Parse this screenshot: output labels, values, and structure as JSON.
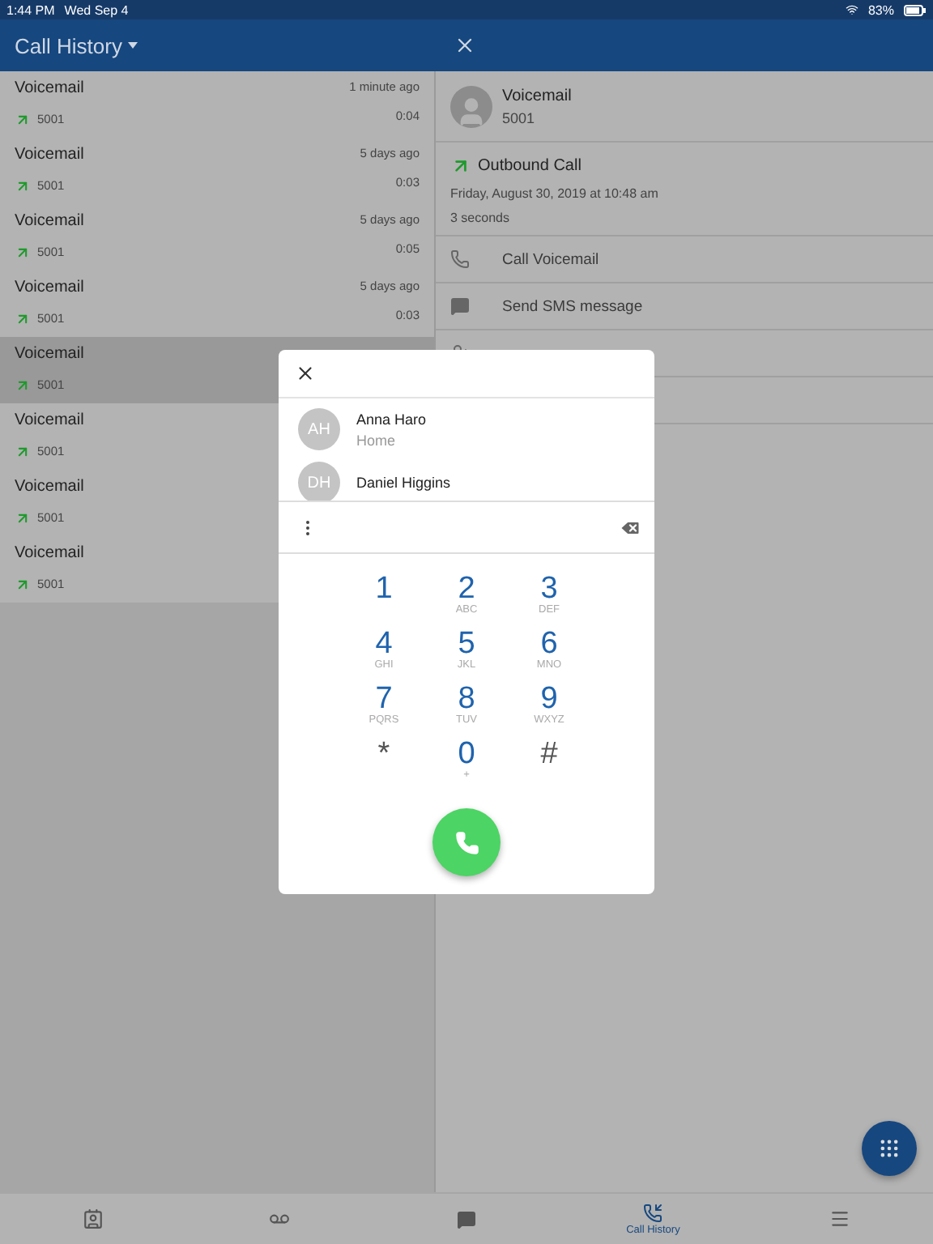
{
  "status_bar": {
    "time": "1:44 PM",
    "date": "Wed Sep 4",
    "battery": "83%"
  },
  "header": {
    "title": "Call History"
  },
  "calls": [
    {
      "name": "Voicemail",
      "number": "5001",
      "when": "1 minute ago",
      "duration": "0:04",
      "selected": false
    },
    {
      "name": "Voicemail",
      "number": "5001",
      "when": "5 days ago",
      "duration": "0:03",
      "selected": false
    },
    {
      "name": "Voicemail",
      "number": "5001",
      "when": "5 days ago",
      "duration": "0:05",
      "selected": false
    },
    {
      "name": "Voicemail",
      "number": "5001",
      "when": "5 days ago",
      "duration": "0:03",
      "selected": false
    },
    {
      "name": "Voicemail",
      "number": "5001",
      "selected": true
    },
    {
      "name": "Voicemail",
      "number": "5001",
      "selected": false
    },
    {
      "name": "Voicemail",
      "number": "5001",
      "selected": false
    },
    {
      "name": "Voicemail",
      "number": "5001",
      "selected": false
    }
  ],
  "detail": {
    "name": "Voicemail",
    "number": "5001",
    "direction": "Outbound Call",
    "date": "Friday, August 30, 2019 at 10:48 am",
    "length": "3 seconds",
    "actions": [
      {
        "kind": "call",
        "label": "Call Voicemail"
      },
      {
        "kind": "sms",
        "label": "Send SMS message"
      },
      {
        "kind": "contact"
      },
      {
        "kind": "blank"
      }
    ]
  },
  "dialer": {
    "suggestions": [
      {
        "initials": "AH",
        "name": "Anna Haro",
        "label": "Home"
      },
      {
        "initials": "DH",
        "name": "Daniel Higgins"
      }
    ],
    "keys": [
      {
        "digit": "1"
      },
      {
        "digit": "2",
        "letters": "ABC"
      },
      {
        "digit": "3",
        "letters": "DEF"
      },
      {
        "digit": "4",
        "letters": "GHI"
      },
      {
        "digit": "5",
        "letters": "JKL"
      },
      {
        "digit": "6",
        "letters": "MNO"
      },
      {
        "digit": "7",
        "letters": "PQRS"
      },
      {
        "digit": "8",
        "letters": "TUV"
      },
      {
        "digit": "9",
        "letters": "WXYZ"
      },
      {
        "digit": "*"
      },
      {
        "digit": "0",
        "letters": "+"
      },
      {
        "digit": "#"
      }
    ]
  },
  "tabs": [
    {
      "kind": "contacts",
      "selected": false
    },
    {
      "kind": "voicemail",
      "selected": false
    },
    {
      "kind": "messages",
      "selected": false
    },
    {
      "kind": "history",
      "label": "Call History",
      "selected": true
    },
    {
      "kind": "menu",
      "selected": false
    }
  ]
}
